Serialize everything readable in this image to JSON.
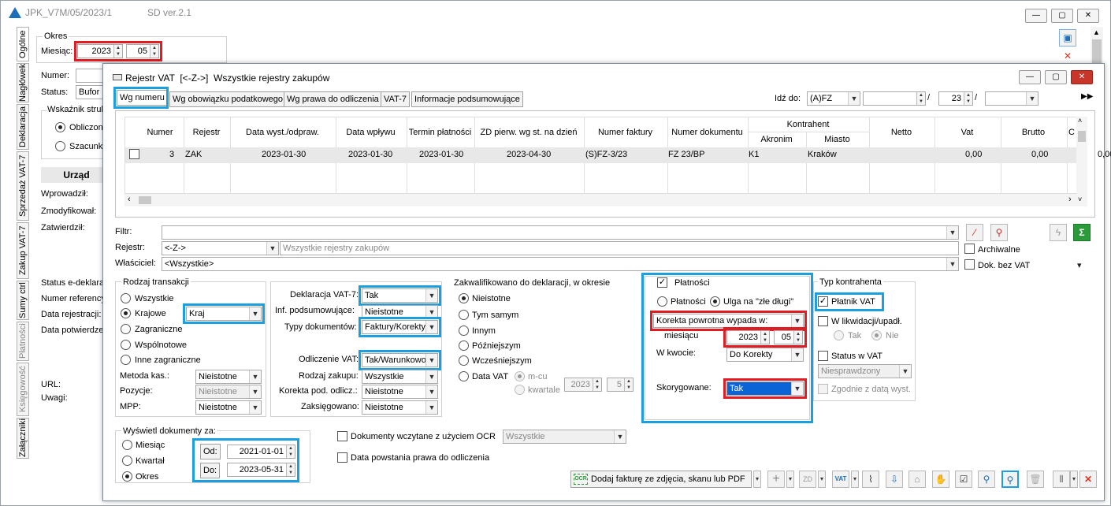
{
  "outer": {
    "title": "JPK_V7M/05/2023/1",
    "version": "SD ver.2.1",
    "okres_label": "Okres",
    "miesiac_label": "Miesiąc:",
    "year": "2023",
    "month": "05",
    "numer_label": "Numer:",
    "status_label": "Status:",
    "status_value": "Bufor",
    "wskaznik_label": "Wskaźnik struk",
    "obliczony": "Obliczony",
    "szacunkowy": "Szacunko",
    "urzad": "Urząd",
    "wprowadzil": "Wprowadził:",
    "zmodyfikowal": "Zmodyfikował:",
    "zatwierdzil": "Zatwierdził:",
    "status_edeklar": "Status e-deklara",
    "numer_referency": "Numer referency",
    "data_rejestracji": "Data rejestracji:",
    "data_potwierdze": "Data potwierdze",
    "url": "URL:",
    "uwagi": "Uwagi:",
    "tabs": [
      "Ogólne",
      "Nagłówek",
      "Deklaracja",
      "Sprzedaż VAT-7",
      "Zakup VAT-7",
      "Sumy ctrl",
      "Płatności",
      "Księgowość",
      "Załączniki"
    ]
  },
  "dialog": {
    "title": "Rejestr VAT  [<-Z->]  Wszystkie rejestry zakupów",
    "tabs": [
      "Wg numeru",
      "Wg obowiązku podatkowego",
      "Wg prawa do odliczenia",
      "VAT-7",
      "Informacje podsumowujące"
    ],
    "idz_do_label": "Idź do:",
    "idz_do_value": "(A)FZ",
    "idz_num": "23",
    "slash": "/",
    "table": {
      "headers": [
        "Numer",
        "Rejestr",
        "Data wyst./odpraw.",
        "Data wpływu",
        "Termin płatności",
        "ZD pierw. wg st. na dzień",
        "Numer faktury",
        "Numer dokumentu",
        "Kontrahent",
        "Akronim",
        "Miasto",
        "Netto",
        "Vat",
        "Brutto",
        "C"
      ],
      "rows": [
        {
          "numer": "3",
          "rejestr": "ZAK",
          "data_wyst": "2023-01-30",
          "data_wplywu": "2023-01-30",
          "termin": "2023-01-30",
          "zd": "2023-04-30",
          "nr_faktury": "(S)FZ-3/23",
          "nr_dok": "FZ 23/BP",
          "akronim": "K1",
          "miasto": "Kraków",
          "netto": "0,00",
          "vat": "0,00",
          "brutto": "0,00"
        }
      ]
    },
    "filtr_label": "Filtr:",
    "rejestr_label": "Rejestr:",
    "rejestr_value": "<-Z->",
    "rejestr_desc": "Wszystkie rejestry zakupów",
    "wlasciciel_label": "Właściciel:",
    "wlasciciel_value": "<Wszystkie>",
    "archiwalne": "Archiwalne",
    "dok_bez_vat": "Dok. bez VAT",
    "rodzaj": {
      "title": "Rodzaj transakcji",
      "options": [
        "Wszystkie",
        "Krajowe",
        "Zagraniczne",
        "Wspólnotowe",
        "Inne zagraniczne"
      ],
      "kraj": "Kraj",
      "metoda_label": "Metoda kas.:",
      "metoda_value": "Nieistotne",
      "pozycje_label": "Pozycje:",
      "pozycje_value": "Nieistotne",
      "mpp_label": "MPP:",
      "mpp_value": "Nieistotne"
    },
    "deklaracja": {
      "dekl_label": "Deklaracja VAT-7:",
      "dekl_value": "Tak",
      "inf_label": "Inf. podsumowujące:",
      "inf_value": "Nieistotne",
      "typy_label": "Typy dokumentów:",
      "typy_value": "Faktury/Korekty",
      "odlicz_label": "Odliczenie VAT:",
      "odlicz_value": "Tak/Warunkowo",
      "rodzaj_label": "Rodzaj zakupu:",
      "rodzaj_value": "Wszystkie",
      "korekta_label": "Korekta pod. odlicz.:",
      "korekta_value": "Nieistotne",
      "zaksieg_label": "Zaksięgowano:",
      "zaksieg_value": "Nieistotne"
    },
    "zakwal": {
      "title": "Zakwalifikowano do deklaracji, w okresie",
      "options": [
        "Nieistotne",
        "Tym samym",
        "Innym",
        "Późniejszym",
        "Wcześniejszym",
        "Data VAT"
      ],
      "mcu": "m-cu",
      "kwartale": "kwartale",
      "year": "2023",
      "num": "5"
    },
    "platnosci": {
      "title": "Płatności",
      "opt1": "Płatności",
      "opt2": "Ulga na \"złe długi\"",
      "korekta_value": "Korekta powrotna wypada w:",
      "miesiacu_label": "miesiącu",
      "year": "2023",
      "month": "05",
      "kwocie_label": "W kwocie:",
      "kwocie_value": "Do Korekty",
      "skoryg_label": "Skorygowane:",
      "skoryg_value": "Tak"
    },
    "typ_kontr": {
      "title": "Typ kontrahenta",
      "platnik": "Płatnik VAT",
      "likwidacji": "W likwidacji/upadł.",
      "tak": "Tak",
      "nie": "Nie",
      "status_vat": "Status w VAT",
      "niesprawdzony": "Niesprawdzony",
      "zgodnie": "Zgodnie z datą wyst."
    },
    "wyswietl": {
      "title": "Wyświetl dokumenty za:",
      "options": [
        "Miesiąc",
        "Kwartał",
        "Okres"
      ],
      "od_label": "Od:",
      "od_value": "2021-01-01",
      "do_label": "Do:",
      "do_value": "2023-05-31"
    },
    "ocr_label": "Dokumenty wczytane z użyciem OCR",
    "ocr_value": "Wszystkie",
    "data_powstania": "Data powstania prawa do odliczenia",
    "dodaj_fakture": "Dodaj fakturę ze zdjęcia, skanu lub PDF",
    "ocr_icon_text": "OCR"
  },
  "colors": {
    "highlight_red": "#e31b23",
    "highlight_blue": "#1aa0e0",
    "selected_blue": "#0a64d6"
  }
}
